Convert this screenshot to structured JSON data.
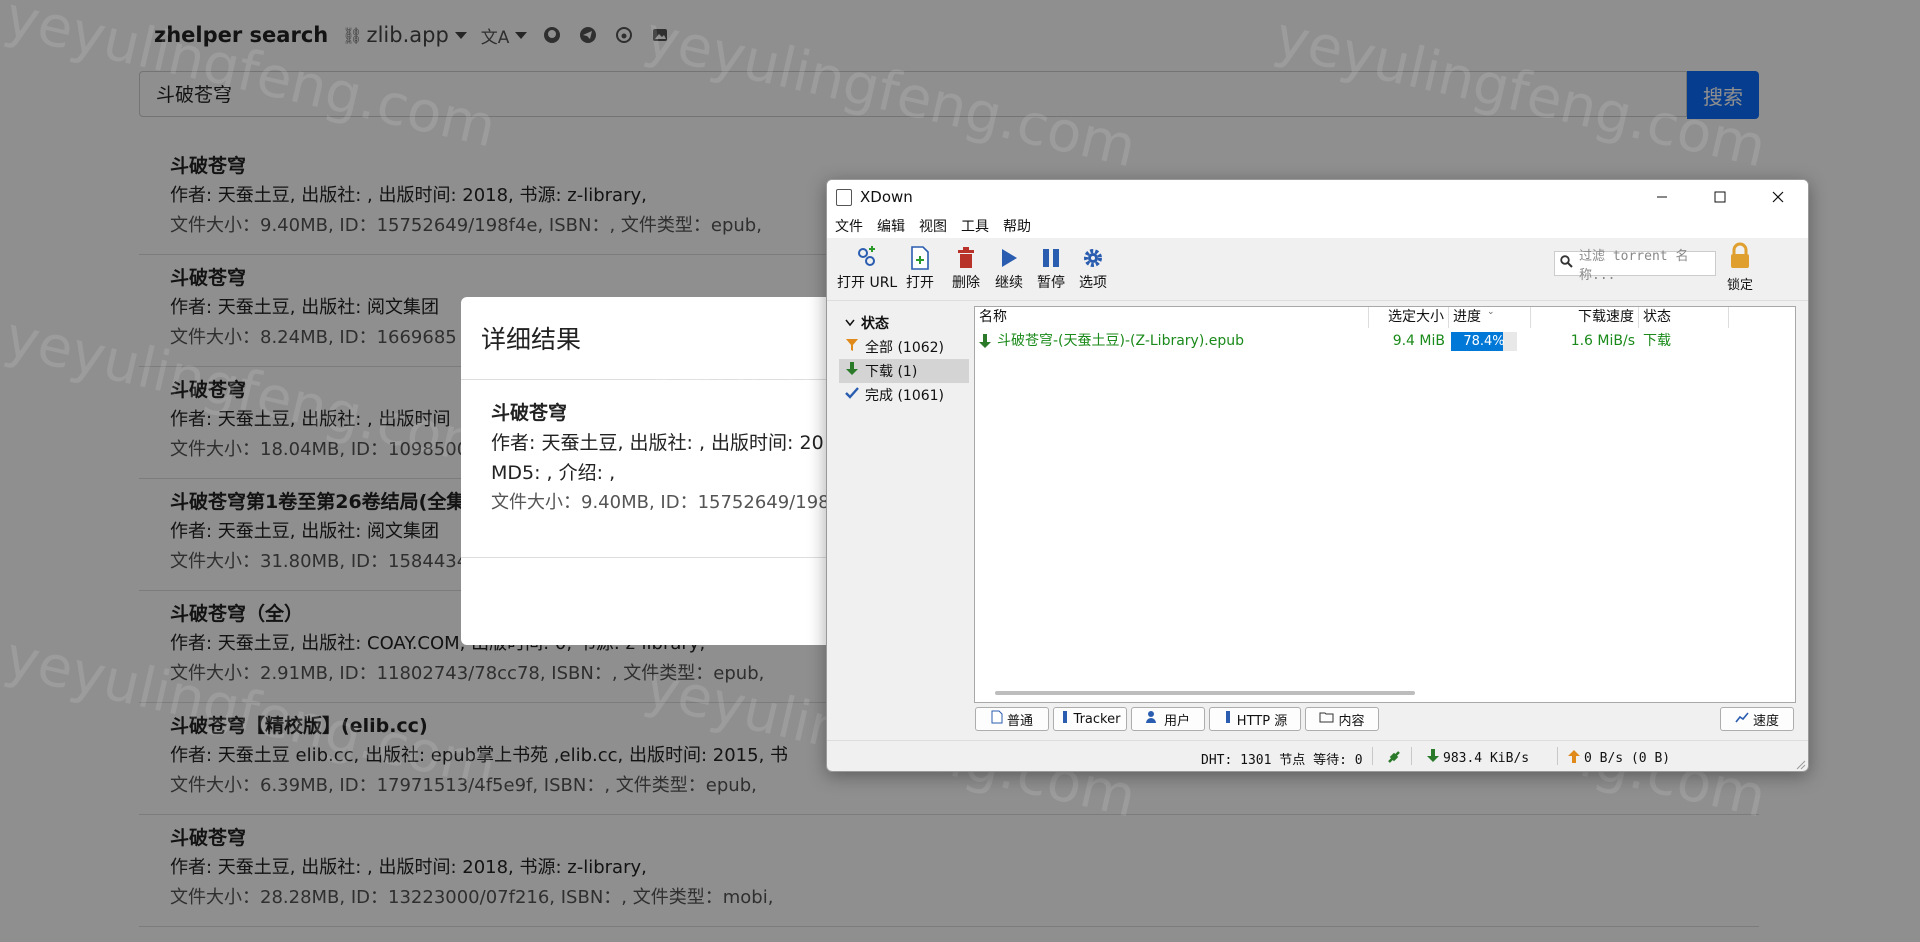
{
  "search_page": {
    "brand": "zhelper search",
    "domain_menu": "zlib.app",
    "search_query": "斗破苍穹",
    "search_button": "搜索",
    "results": [
      {
        "title": "斗破苍穹",
        "line": "作者: 天蚕土豆, 出版社: , 出版时间: 2018, 书源: z-library,",
        "meta": "文件大小：9.40MB, ID：15752649/198f4e, ISBN：, 文件类型：epub,"
      },
      {
        "title": "斗破苍穹",
        "line": "作者: 天蚕土豆, 出版社: 阅文集团",
        "meta": "文件大小：8.24MB, ID：1669685"
      },
      {
        "title": "斗破苍穹",
        "line": "作者: 天蚕土豆, 出版社: , 出版时间",
        "meta": "文件大小：18.04MB, ID：1098500"
      },
      {
        "title": "斗破苍穹第1卷至第26卷结局(全集",
        "line": "作者: 天蚕土豆, 出版社: 阅文集团",
        "meta": "文件大小：31.80MB, ID：1584434"
      },
      {
        "title": "斗破苍穹（全）",
        "line": "作者: 天蚕土豆, 出版社: COAY.COM, 出版时间: 0, 书源: z-library,",
        "meta": "文件大小：2.91MB, ID：11802743/78cc78, ISBN：, 文件类型：epub,"
      },
      {
        "title": "斗破苍穹【精校版】(elib.cc)",
        "line": "作者: 天蚕土豆 elib.cc, 出版社: epub掌上书苑 ,elib.cc, 出版时间: 2015, 书",
        "meta": "文件大小：6.39MB, ID：17971513/4f5e9f, ISBN：, 文件类型：epub,"
      },
      {
        "title": "斗破苍穹",
        "line": "作者: 天蚕土豆, 出版社: , 出版时间: 2018, 书源: z-library,",
        "meta": "文件大小：28.28MB, ID：13223000/07f216, ISBN：, 文件类型：mobi,"
      }
    ],
    "watermark": "yeyulingfeng.com"
  },
  "modal": {
    "header": "详细结果",
    "title": "斗破苍穹",
    "line1": "作者: 天蚕土豆, 出版社: , 出版时间: 20",
    "line2": "MD5: , 介绍: ,",
    "meta": "文件大小：9.40MB, ID：15752649/198"
  },
  "xdown": {
    "title": "XDown",
    "menu": [
      "文件",
      "编辑",
      "视图",
      "工具",
      "帮助"
    ],
    "toolbar": {
      "open_url": "打开 URL",
      "open": "打开",
      "delete": "删除",
      "resume": "继续",
      "pause": "暂停",
      "options": "选项",
      "lock": "锁定"
    },
    "filter_placeholder": "过滤 torrent 名称...",
    "sidebar": {
      "header": "状态",
      "all": "全部 (1062)",
      "downloading": "下载 (1)",
      "completed": "完成 (1061)"
    },
    "columns": {
      "name": "名称",
      "size": "选定大小",
      "progress": "进度",
      "speed": "下载速度",
      "status": "状态"
    },
    "rows": [
      {
        "name": "斗破苍穹-(天蚕土豆)-(Z-Library).epub",
        "size": "9.4 MiB",
        "progress_label": "78.4%",
        "progress": 0.784,
        "speed": "1.6 MiB/s",
        "status": "下载"
      }
    ],
    "tabs": {
      "general": "普通",
      "tracker": "Tracker",
      "peers": "用户",
      "http": "HTTP 源",
      "content": "内容",
      "speed": "速度"
    },
    "statusbar": {
      "dht": "DHT: 1301 节点 等待: 0",
      "down": "983.4 KiB/s",
      "up": "0 B/s (0 B)"
    },
    "colors": {
      "accent": "#0078d7",
      "download_green": "#1a8a1a",
      "upload_orange": "#e08a1c"
    }
  }
}
